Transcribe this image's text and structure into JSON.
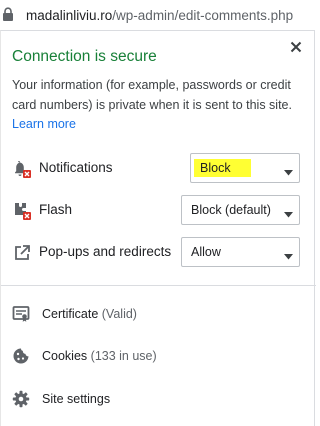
{
  "address_bar": {
    "host": "madalinliviu.ro",
    "path": "/wp-admin/edit-comments.php"
  },
  "popup": {
    "title": "Connection is secure",
    "description": "Your information (for example, passwords or credit card numbers) is private when it is sent to this site.",
    "learn_more": "Learn more",
    "title_color": "#188038",
    "link_color": "#1a73e8",
    "highlight_color": "#ffff33"
  },
  "permissions": [
    {
      "label": "Notifications",
      "value": "Block",
      "icon": "notifications-blocked-icon"
    },
    {
      "label": "Flash",
      "value": "Block (default)",
      "icon": "flash-blocked-icon"
    },
    {
      "label": "Pop-ups and redirects",
      "value": "Allow",
      "icon": "popup-icon"
    }
  ],
  "links": {
    "certificate": {
      "label": "Certificate",
      "sub": "(Valid)",
      "icon": "certificate-icon"
    },
    "cookies": {
      "label": "Cookies",
      "sub": "(133 in use)",
      "icon": "cookie-icon"
    },
    "site_settings": {
      "label": "Site settings",
      "icon": "gear-icon"
    }
  }
}
